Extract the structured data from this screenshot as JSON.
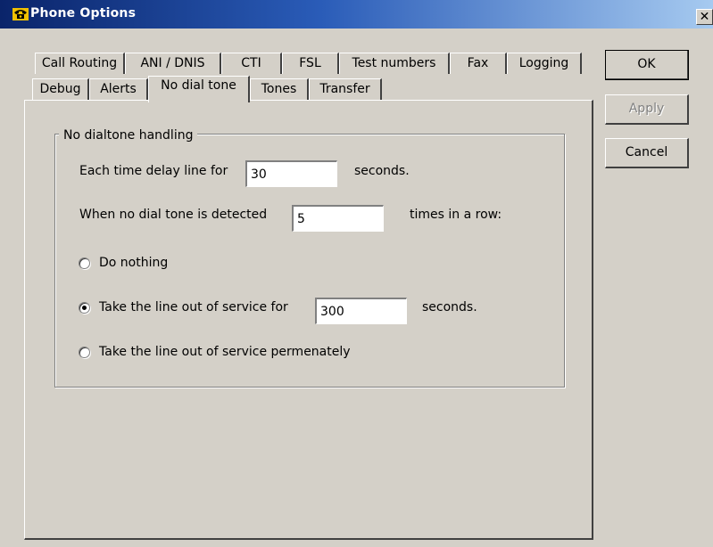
{
  "window": {
    "title": "Phone Options",
    "close_label": "✕"
  },
  "tabs": {
    "row1": [
      "Call Routing",
      "ANI / DNIS",
      "CTI",
      "FSL",
      "Test numbers",
      "Fax",
      "Logging"
    ],
    "row2": [
      "Debug",
      "Alerts",
      "No dial tone",
      "Tones",
      "Transfer"
    ],
    "active": "No dial tone"
  },
  "buttons": {
    "ok": "OK",
    "apply": "Apply",
    "cancel": "Cancel"
  },
  "group": {
    "title": "No dialtone handling",
    "delay_label": "Each time delay line for",
    "delay_value": "30",
    "delay_unit": "seconds.",
    "detect_label": "When no dial tone is detected",
    "detect_value": "5",
    "detect_unit": "times in a row:",
    "options": {
      "do_nothing": "Do nothing",
      "out_of_service_for": "Take the line out of service for",
      "out_of_service_value": "300",
      "out_of_service_unit": "seconds.",
      "out_of_service_permanent": "Take the line out of service permenately"
    },
    "selected_option": "out_of_service_for"
  },
  "icons": {
    "app": "telephone-icon",
    "close": "close-icon"
  },
  "colors": {
    "titlebar": "#0a246a",
    "face": "#d4d0c8"
  }
}
